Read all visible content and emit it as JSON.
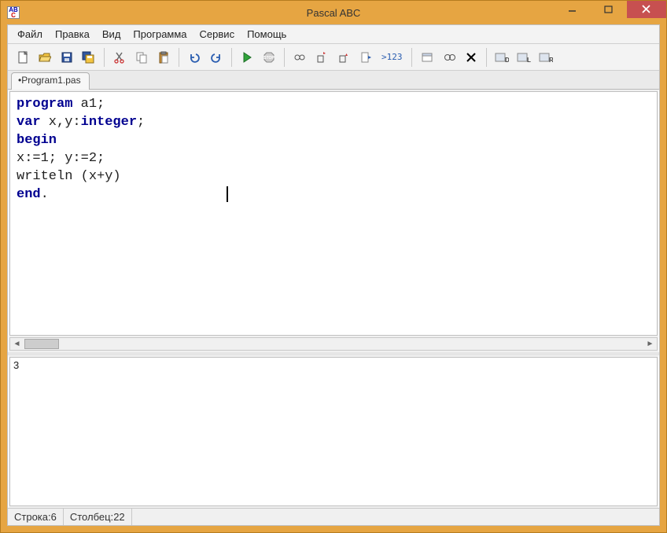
{
  "window": {
    "title": "Pascal ABC",
    "app_icon_top": "AB",
    "app_icon_bottom": "C"
  },
  "menu": {
    "file": "Файл",
    "edit": "Правка",
    "view": "Вид",
    "program": "Программа",
    "service": "Сервис",
    "help": "Помощь"
  },
  "toolbar": {
    "var_btn": ">123"
  },
  "tab": {
    "file1": "•Program1.pas"
  },
  "code": {
    "kw_program": "program",
    "name": " a1;",
    "kw_var": "var",
    "vars": " x,y:",
    "ty_integer": "integer",
    "semi": ";",
    "kw_begin": "begin",
    "line4": "x:=1; y:=2;",
    "line5": "writeln (x+y)",
    "kw_end": "end",
    "dot": "."
  },
  "output": {
    "text": "3"
  },
  "status": {
    "line_label": "Строка: ",
    "line_value": "6",
    "col_label": "Столбец: ",
    "col_value": "22"
  }
}
